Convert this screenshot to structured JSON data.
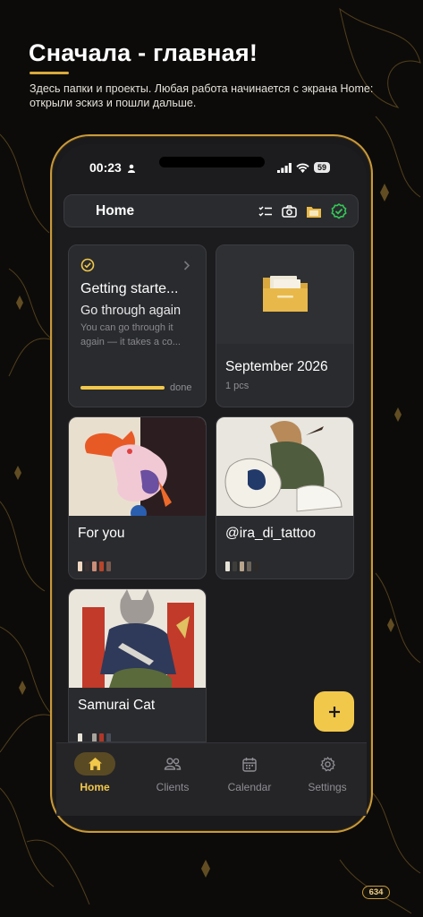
{
  "slide": {
    "headline": "Сначала - главная!",
    "subtitle": "Здесь папки и проекты. Любая работа начинается с экрана Home: открыли эскиз и пошли дальше.",
    "page_number": "634"
  },
  "status_bar": {
    "time": "00:23",
    "battery": "59"
  },
  "topbar": {
    "title": "Home"
  },
  "cards": {
    "getting_started": {
      "title": "Getting starte...",
      "subtitle": "Go through again",
      "description": "You can go through it again — it takes a co...",
      "progress": 1.0,
      "progress_label": "done"
    },
    "folder": {
      "title": "September 2026",
      "count": "1 pcs"
    },
    "for_you": {
      "title": "For you"
    },
    "ira": {
      "title": "@ira_di_tattoo"
    },
    "samurai": {
      "title": "Samurai Cat"
    }
  },
  "nav": {
    "home": "Home",
    "clients": "Clients",
    "calendar": "Calendar",
    "settings": "Settings"
  },
  "fab": {
    "label": "+"
  },
  "colors": {
    "accent": "#f2c84b",
    "gold": "#c99a3b",
    "card": "#2a2b2e",
    "screen": "#1c1c1e"
  }
}
